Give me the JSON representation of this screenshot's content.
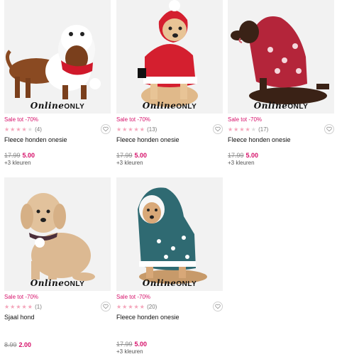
{
  "products": [
    {
      "sale": "Sale tot -70%",
      "stars": 4,
      "reviews": "(4)",
      "name": "Fleece honden onesie",
      "old_price": "17.99",
      "new_price": "5.00",
      "colors": "+3 kleuren",
      "badge_a": "Online",
      "badge_b": "ONLY",
      "colors_hex": {
        "background": "#f1f1f1",
        "outfit": "#ffffff",
        "accent": "#d0192b"
      }
    },
    {
      "sale": "Sale tot -70%",
      "stars": 5,
      "reviews": "(13)",
      "name": "Fleece honden onesie",
      "old_price": "17.99",
      "new_price": "5.00",
      "colors": "+3 kleuren",
      "badge_a": "Online",
      "badge_b": "ONLY",
      "colors_hex": {
        "background": "#f1f1f1",
        "outfit": "#d41f2f",
        "accent": "#ffffff"
      }
    },
    {
      "sale": "Sale tot -70%",
      "stars": 4,
      "reviews": "(17)",
      "name": "Fleece honden onesie",
      "old_price": "17.99",
      "new_price": "5.00",
      "colors": "+3 kleuren",
      "badge_a": "Online",
      "badge_b": "ONLY",
      "colors_hex": {
        "background": "#f1f1f1",
        "outfit": "#b4253a",
        "accent": "#f4d7dc"
      }
    },
    {
      "sale": "Sale tot -70%",
      "stars": 5,
      "reviews": "(1)",
      "name": "Sjaal hond",
      "old_price": "8.99",
      "new_price": "2.00",
      "colors": "",
      "badge_a": "Online",
      "badge_b": "ONLY",
      "colors_hex": {
        "background": "#f1f1f1",
        "outfit": "#4a2e3a",
        "accent": "#ffffff"
      }
    },
    {
      "sale": "Sale tot -70%",
      "stars": 5,
      "reviews": "(20)",
      "name": "Fleece honden onesie",
      "old_price": "17.99",
      "new_price": "5.00",
      "colors": "+3 kleuren",
      "badge_a": "Online",
      "badge_b": "ONLY",
      "colors_hex": {
        "background": "#f1f1f1",
        "outfit": "#2f6a72",
        "accent": "#ffffff"
      }
    }
  ],
  "icons": {
    "wishlist": "heart-outline-icon",
    "rating": "star-icon"
  },
  "theme": {
    "sale_color": "#d6116a",
    "star_color": "#f4a3b9"
  }
}
